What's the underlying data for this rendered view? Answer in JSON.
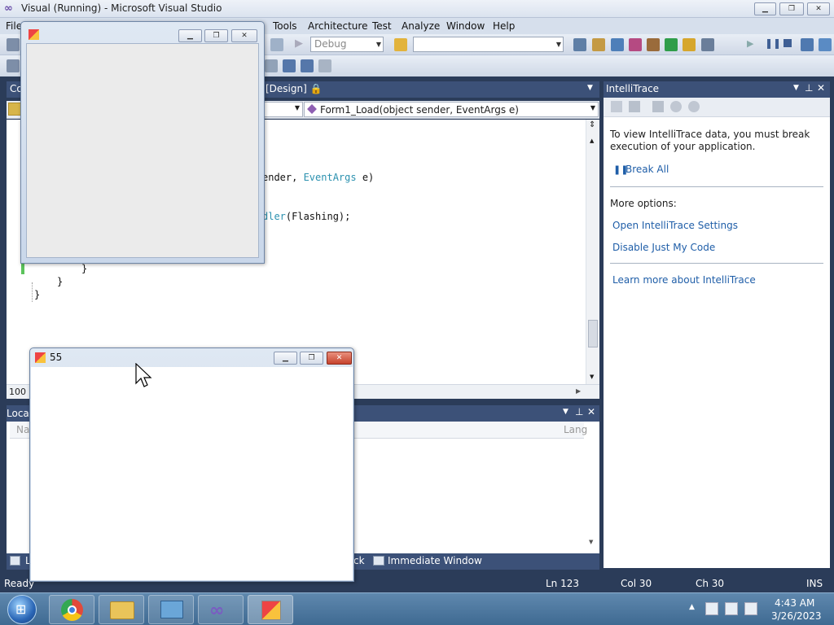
{
  "window": {
    "title": "Visual (Running) - Microsoft Visual Studio",
    "min_label": "▁",
    "max_label": "❐",
    "close_label": "✕"
  },
  "menu": {
    "items": [
      "File",
      "Tools",
      "Architecture",
      "Test",
      "Analyze",
      "Window",
      "Help"
    ]
  },
  "toolbar": {
    "config_value": "Debug",
    "platform_value": ""
  },
  "editor": {
    "tab_label": "[Design] 🔒",
    "partial_tab": "Co",
    "method_dropdown": "Form1_Load(object sender, EventArgs e)",
    "zoom": "100 %",
    "code_line1": "ender, ",
    "code_type": "EventArgs",
    "code_line1_end": " e)",
    "code_line2_kw": "dler",
    "code_line2_end": "(Flashing);",
    "brace1": "}",
    "brace2": "}",
    "brace3": "}"
  },
  "intellitrace": {
    "title": "IntelliTrace",
    "message": "To view IntelliTrace data, you must break execution of your application.",
    "break_all": "Break All",
    "more_options": "More options:",
    "open_settings": "Open IntelliTrace Settings",
    "disable_jmc": "Disable Just My Code",
    "learn_more": "Learn more about IntelliTrace"
  },
  "locals": {
    "title": "Local",
    "col_name": "Na",
    "col_lang": "Lang"
  },
  "bottom_tabs": {
    "locals_tab": "L",
    "callstack_tab": "ck",
    "immediate": "Immediate Window"
  },
  "status": {
    "ready": "Ready",
    "ln": "Ln 123",
    "col": "Col 30",
    "ch": "Ch 30",
    "ins": "INS"
  },
  "taskbar": {
    "time": "4:43 AM",
    "date": "3/26/2023"
  },
  "forms": {
    "form1_title": "",
    "form2_title": "55"
  },
  "colors": {
    "accent": "#3c5178",
    "link": "#1f5ea8",
    "type_keyword": "#2b91af"
  }
}
